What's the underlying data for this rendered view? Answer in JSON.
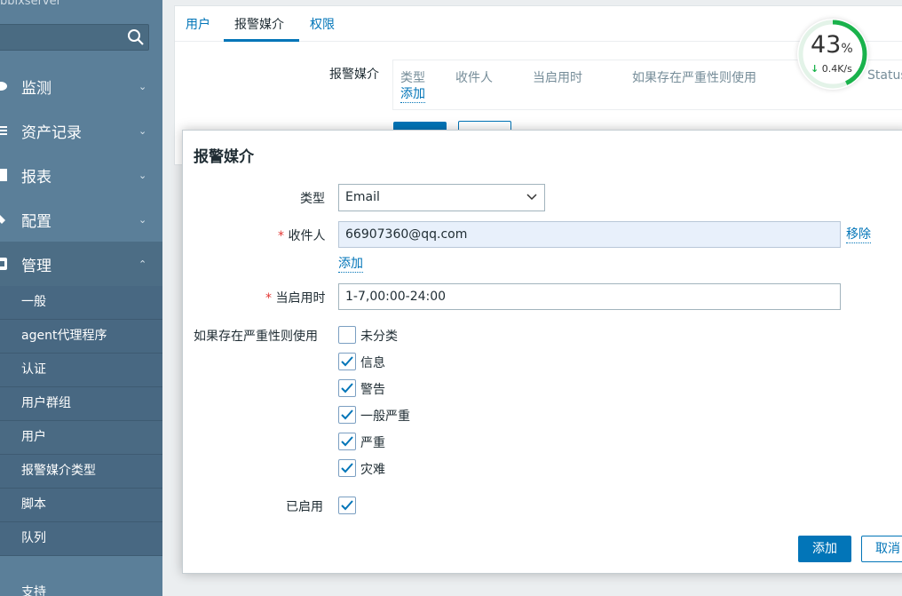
{
  "sidebar": {
    "logo_text": "bbixserver",
    "menu": [
      {
        "label": "监测"
      },
      {
        "label": "资产记录"
      },
      {
        "label": "报表"
      },
      {
        "label": "配置"
      },
      {
        "label": "管理"
      }
    ],
    "submenu": [
      "一般",
      "agent代理程序",
      "认证",
      "用户群组",
      "用户",
      "报警媒介类型",
      "脚本",
      "队列"
    ],
    "support": "支持"
  },
  "tabs": [
    "用户",
    "报警媒介",
    "权限"
  ],
  "media_section": {
    "label": "报警媒介",
    "headers": [
      "类型",
      "收件人",
      "当启用时",
      "如果存在严重性则使用",
      "Status"
    ],
    "add_link": "添加"
  },
  "speed_widget": {
    "percent": "43",
    "percent_unit": "%",
    "rate": "0.4K/s",
    "progress": 0.43
  },
  "dialog": {
    "title": "报警媒介",
    "type_label": "类型",
    "type_value": "Email",
    "recipient_label": "收件人",
    "recipient_value": "66907360@qq.com",
    "remove_link": "移除",
    "add_link": "添加",
    "when_active_label": "当启用时",
    "when_active_value": "1-7,00:00-24:00",
    "severity_label": "如果存在严重性则使用",
    "severities": [
      {
        "label": "未分类",
        "checked": false
      },
      {
        "label": "信息",
        "checked": true
      },
      {
        "label": "警告",
        "checked": true
      },
      {
        "label": "一般严重",
        "checked": true
      },
      {
        "label": "严重",
        "checked": true
      },
      {
        "label": "灾难",
        "checked": true
      }
    ],
    "enabled_label": "已启用",
    "enabled": true,
    "add_button": "添加",
    "cancel_button": "取消"
  },
  "colors": {
    "sidebar": "#5b7f99",
    "accent": "#0275b8",
    "required": "#e33734",
    "speed_ring": "#19b24b"
  }
}
